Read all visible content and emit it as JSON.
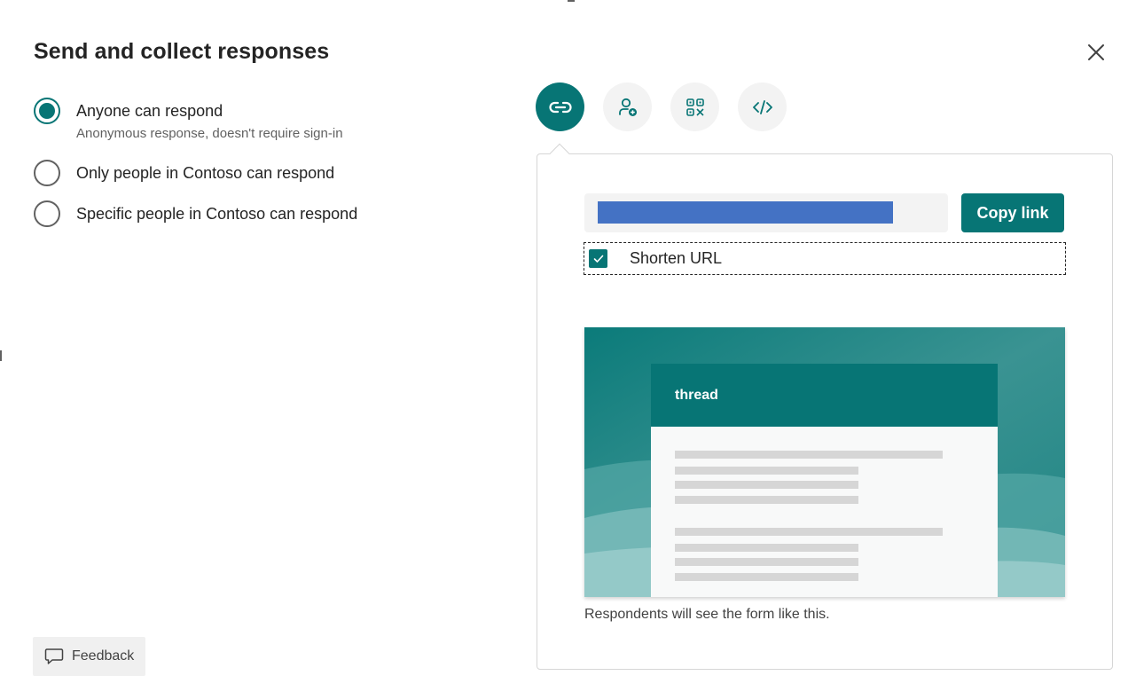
{
  "dialog": {
    "title": "Send and collect responses",
    "close_icon": "close-icon"
  },
  "audience": {
    "options": [
      {
        "label": "Anyone can respond",
        "description": "Anonymous response, doesn't require sign-in",
        "selected": true
      },
      {
        "label": "Only people in Contoso can respond",
        "selected": false
      },
      {
        "label": "Specific people in Contoso can respond",
        "selected": false
      }
    ]
  },
  "share_tabs": [
    {
      "icon": "link-icon",
      "active": true
    },
    {
      "icon": "person-add-icon",
      "active": false
    },
    {
      "icon": "qr-code-icon",
      "active": false
    },
    {
      "icon": "embed-code-icon",
      "active": false
    }
  ],
  "link_panel": {
    "copy_button_label": "Copy link",
    "shorten_url": {
      "label": "Shorten URL",
      "checked": true
    },
    "preview": {
      "form_title": "thread"
    },
    "caption": "Respondents will see the form like this."
  },
  "footer": {
    "feedback_label": "Feedback",
    "feedback_icon": "comment-icon"
  },
  "colors": {
    "accent": "#077575",
    "redaction": "#4472c4",
    "tab_inactive": "#f3f3f3"
  }
}
